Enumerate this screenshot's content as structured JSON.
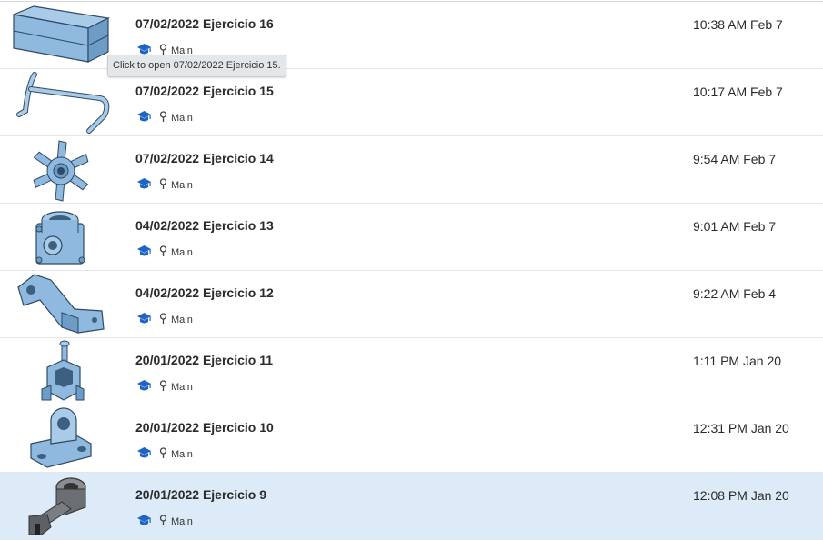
{
  "colors": {
    "accent_blue": "#1d64c4",
    "part_blue": "#8fb9de",
    "part_edge": "#2d4a66",
    "part_gray": "#6b6e72",
    "selected_row": "#dcebf7"
  },
  "tooltip": {
    "text": "Click to open 07/02/2022 Ejercicio 15."
  },
  "documents": [
    {
      "title": "07/02/2022 Ejercicio 16",
      "branch": "Main",
      "modified": "10:38 AM Feb 7",
      "thumbnail_icon": "enclosure-box-icon"
    },
    {
      "title": "07/02/2022 Ejercicio 15",
      "branch": "Main",
      "modified": "10:17 AM Feb 7",
      "thumbnail_icon": "bent-pipe-icon"
    },
    {
      "title": "07/02/2022 Ejercicio 14",
      "branch": "Main",
      "modified": "9:54 AM Feb 7",
      "thumbnail_icon": "star-wheel-icon"
    },
    {
      "title": "04/02/2022 Ejercicio 13",
      "branch": "Main",
      "modified": "9:01 AM Feb 7",
      "thumbnail_icon": "pipe-fitting-icon"
    },
    {
      "title": "04/02/2022 Ejercicio 12",
      "branch": "Main",
      "modified": "9:22 AM Feb 4",
      "thumbnail_icon": "angle-bracket-icon"
    },
    {
      "title": "20/01/2022 Ejercicio 11",
      "branch": "Main",
      "modified": "1:11 PM Jan 20",
      "thumbnail_icon": "vise-part-icon"
    },
    {
      "title": "20/01/2022 Ejercicio 10",
      "branch": "Main",
      "modified": "12:31 PM Jan 20",
      "thumbnail_icon": "pillow-block-icon"
    },
    {
      "title": "20/01/2022 Ejercicio 9",
      "branch": "Main",
      "modified": "12:08 PM Jan 20",
      "thumbnail_icon": "clevis-arm-icon",
      "selected": true
    }
  ]
}
